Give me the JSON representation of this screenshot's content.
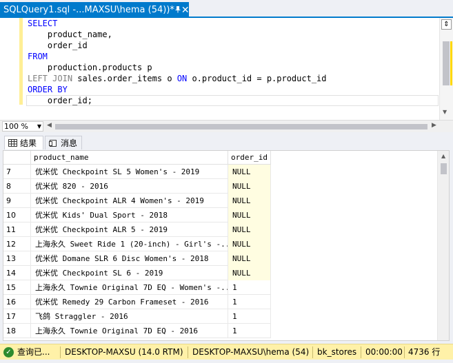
{
  "tab": {
    "title": "SQLQuery1.sql -...MAXSU\\hema (54))*",
    "pin_icon": "pin-icon",
    "close_glyph": "✕"
  },
  "editor": {
    "lines": [
      [
        "SELECT"
      ],
      [
        "    product_name,"
      ],
      [
        "    order_id"
      ],
      [
        "FROM"
      ],
      [
        "    production.products p"
      ],
      [
        "LEFT JOIN sales.order_items o ON o.product_id = p.product_id"
      ],
      [
        "ORDER BY"
      ],
      [
        "    order_id;"
      ]
    ],
    "kw_select": "SELECT",
    "l1": "    product_name,",
    "l2": "    order_id",
    "kw_from": "FROM",
    "l4": "    production.products p",
    "kw_left": "LEFT",
    "kw_join": "JOIN",
    "l5a": " sales.order_items o ",
    "kw_on": "ON",
    "l5b": " o.product_id = p.product_id",
    "kw_order": "ORDER BY",
    "l7": "    order_id;"
  },
  "zoom": {
    "value": "100 %"
  },
  "result_tabs": {
    "results": "结果",
    "messages": "消息"
  },
  "grid": {
    "columns": [
      "product_name",
      "order_id"
    ],
    "rows": [
      {
        "n": "7",
        "name": "优米优 Checkpoint SL 5 Women's - 2019",
        "id": "NULL"
      },
      {
        "n": "8",
        "name": "优米优 820 - 2016",
        "id": "NULL"
      },
      {
        "n": "9",
        "name": "优米优 Checkpoint ALR 4 Women's - 2019",
        "id": "NULL"
      },
      {
        "n": "10",
        "name": "优米优 Kids' Dual Sport - 2018",
        "id": "NULL"
      },
      {
        "n": "11",
        "name": "优米优 Checkpoint ALR 5 - 2019",
        "id": "NULL"
      },
      {
        "n": "12",
        "name": "上海永久 Sweet Ride 1 (20-inch) - Girl's -...",
        "id": "NULL"
      },
      {
        "n": "13",
        "name": "优米优 Domane SLR 6 Disc Women's - 2018",
        "id": "NULL"
      },
      {
        "n": "14",
        "name": "优米优 Checkpoint SL 6 - 2019",
        "id": "NULL"
      },
      {
        "n": "15",
        "name": "上海永久 Townie Original 7D EQ - Women's -...",
        "id": "1"
      },
      {
        "n": "16",
        "name": "优米优 Remedy 29 Carbon Frameset - 2016",
        "id": "1"
      },
      {
        "n": "17",
        "name": "飞鸽 Straggler - 2016",
        "id": "1"
      },
      {
        "n": "18",
        "name": "上海永久 Townie Original 7D EQ - 2016",
        "id": "1"
      }
    ]
  },
  "status": {
    "state": "查询已...",
    "server": "DESKTOP-MAXSU (14.0 RTM)",
    "user": "DESKTOP-MAXSU\\hema (54)",
    "database": "bk_stores",
    "elapsed": "00:00:00",
    "rows": "4736 行"
  }
}
